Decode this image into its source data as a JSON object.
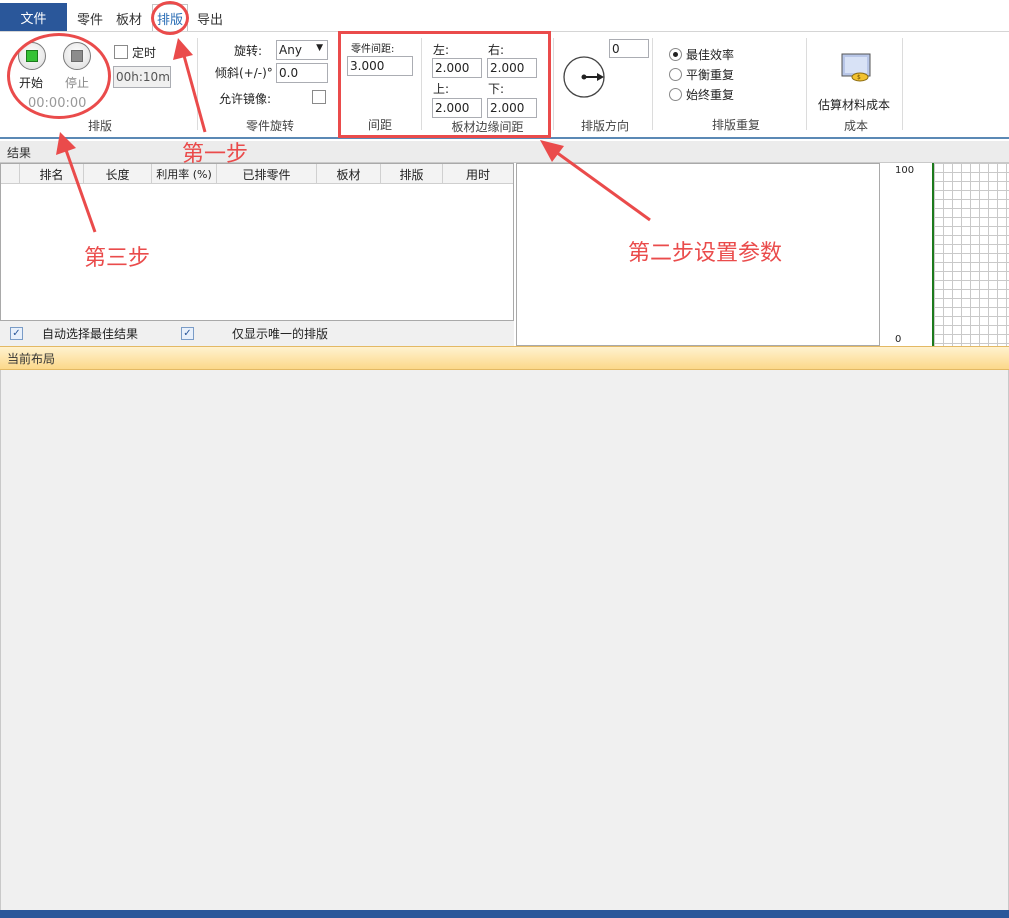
{
  "tabs": {
    "file": "文件",
    "items": [
      "零件",
      "板材",
      "排版",
      "导出"
    ],
    "active": "排版"
  },
  "ribbon": {
    "nest_group": {
      "start": "开始",
      "stop": "停止",
      "timer_label": "定时",
      "timer_value": "00h:10m",
      "elapsed": "00:00:00",
      "group_label": "排版"
    },
    "rotation_group": {
      "rotation_label": "旋转:",
      "rotation_value": "Any",
      "tilt_label": "倾斜(+/-)°",
      "tilt_value": "0.0",
      "mirror_label": "允许镜像:",
      "group_label": "零件旋转"
    },
    "spacing_group": {
      "part_spacing_label": "零件间距:",
      "part_spacing_value": "3.000",
      "group_label": "间距"
    },
    "margin_group": {
      "left_label": "左:",
      "left_value": "2.000",
      "right_label": "右:",
      "right_value": "2.000",
      "top_label": "上:",
      "top_value": "2.000",
      "bottom_label": "下:",
      "bottom_value": "2.000",
      "group_label": "板材边缘间距"
    },
    "direction_group": {
      "angle_value": "0",
      "group_label": "排版方向"
    },
    "repeat_group": {
      "options": [
        "最佳效率",
        "平衡重复",
        "始终重复"
      ],
      "selected": "最佳效率",
      "group_label": "排版重复"
    },
    "cost_group": {
      "button_label": "估算材料成本",
      "group_label": "成本"
    }
  },
  "results": {
    "title": "结果",
    "columns": [
      "排名",
      "长度",
      "利用率 (%)",
      "已排零件",
      "板材",
      "排版",
      "用时"
    ],
    "auto_select_label": "自动选择最佳结果",
    "unique_only_label": "仅显示唯一的排版",
    "axis_top": "100",
    "axis_bottom": "0"
  },
  "layout": {
    "title": "当前布局"
  },
  "annotations": {
    "step1": "第一步",
    "step2": "第二步设置参数",
    "step3": "第三步",
    "color": "#ea4b4b"
  }
}
